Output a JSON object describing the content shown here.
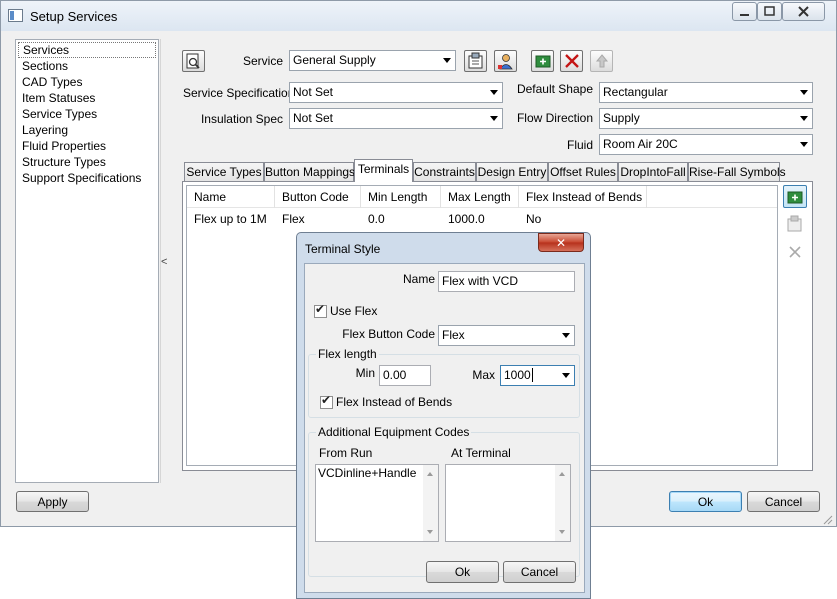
{
  "window": {
    "title": "Setup Services"
  },
  "left_list": {
    "items": [
      "Services",
      "Sections",
      "CAD Types",
      "Item Statuses",
      "Service Types",
      "Layering",
      "Fluid Properties",
      "Structure Types",
      "Support Specifications"
    ],
    "selected": "Services"
  },
  "splitter": {
    "arrow": "<"
  },
  "form": {
    "service_label": "Service",
    "service_value": "General Supply",
    "service_spec_label": "Service Specification",
    "service_spec_value": "Not Set",
    "insulation_label": "Insulation Spec",
    "insulation_value": "Not Set",
    "default_shape_label": "Default Shape",
    "default_shape_value": "Rectangular",
    "flow_direction_label": "Flow Direction",
    "flow_direction_value": "Supply",
    "fluid_label": "Fluid",
    "fluid_value": "Room Air 20C"
  },
  "tabs": [
    "Service Types",
    "Button Mappings",
    "Terminals",
    "Constraints",
    "Design Entry",
    "Offset Rules",
    "DropIntoFall",
    "Rise-Fall Symbols"
  ],
  "active_tab": "Terminals",
  "grid": {
    "columns": [
      "Name",
      "Button Code",
      "Min Length",
      "Max Length",
      "Flex Instead of Bends"
    ],
    "rows": [
      [
        "Flex up to 1M",
        "Flex",
        "0.0",
        "1000.0",
        "No"
      ]
    ]
  },
  "buttons": {
    "apply": "Apply",
    "ok": "Ok",
    "cancel": "Cancel"
  },
  "dialog": {
    "title": "Terminal Style",
    "close_glyph": "✕",
    "name_label": "Name",
    "name_value": "Flex with VCD",
    "use_flex_label": "Use Flex",
    "use_flex_checked": true,
    "flex_button_code_label": "Flex Button Code",
    "flex_button_code_value": "Flex",
    "flex_length_title": "Flex length",
    "min_label": "Min",
    "min_value": "0.00",
    "max_label": "Max",
    "max_value": "1000",
    "flex_instead_label": "Flex Instead of Bends",
    "flex_instead_checked": true,
    "additional_title": "Additional Equipment Codes",
    "from_run_label": "From Run",
    "at_terminal_label": "At Terminal",
    "from_run_items": [
      "VCDinline+Handle"
    ],
    "at_terminal_items": [],
    "ok": "Ok",
    "cancel": "Cancel"
  },
  "colors": {
    "accent_blue": "#3c7fb1",
    "close_red": "#c7452d",
    "dialog_frame": "#cfdceb"
  }
}
